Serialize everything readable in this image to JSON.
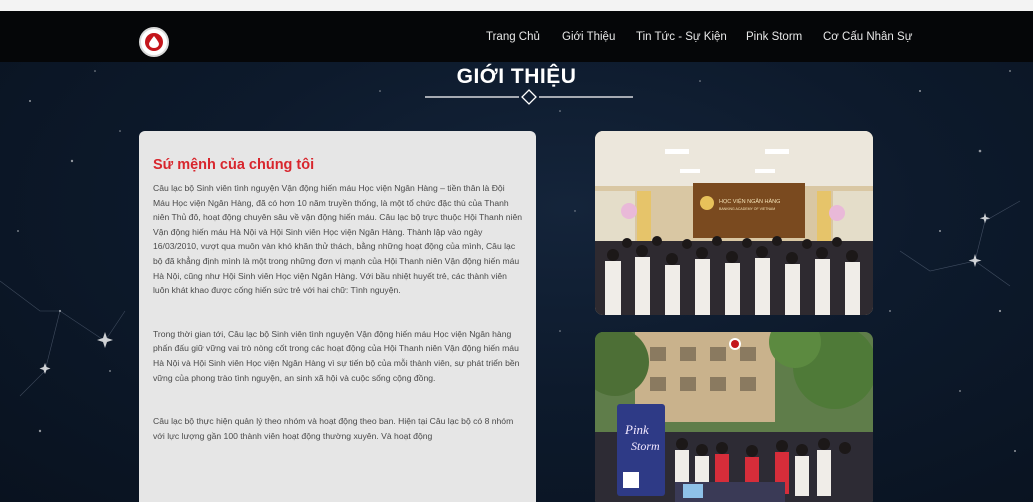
{
  "nav": {
    "items": [
      "Trang Chủ",
      "Giới Thiệu",
      "Tin Tức - Sự Kiện",
      "Pink Storm",
      "Cơ Cấu Nhân Sự"
    ]
  },
  "section_title": "GIỚI THIỆU",
  "mission": {
    "heading": "Sứ mệnh của chúng tôi",
    "paragraphs": [
      "Câu lạc bộ Sinh viên tình nguyện Vận động hiến máu Học viện Ngân Hàng – tiền thân là Đội Máu Học viện Ngân Hàng, đã có hơn 10 năm truyền thống, là một tổ chức đặc thù của Thanh niên Thủ đô, hoạt động chuyên sâu về vận động hiến máu. Câu lạc bộ trực thuộc Hội Thanh niên Vận động hiến máu Hà Nội và Hội Sinh viên Học viện Ngân Hàng. Thành lập vào ngày 16/03/2010, vượt qua muôn vàn khó khăn thử thách, bằng những hoạt động của mình, Câu lạc bộ đã khẳng định mình là một trong những đơn vị mạnh của Hội Thanh niên Vận động hiến máu Hà Nội, cũng như Hội Sinh viên Học viện Ngân Hàng. Với bầu nhiệt huyết trẻ, các thành viên luôn khát khao được cống hiến sức trẻ với hai chữ: Tình nguyện.",
      "Trong thời gian tới, Câu lạc bộ Sinh viên tình nguyện Vận động hiến máu Học viện Ngân hàng phấn đấu giữ vững vai trò nòng cốt trong các hoạt động của Hội Thanh niên Vận động hiến máu Hà Nội và Hội Sinh viên Học viện Ngân Hàng vì sự tiến bộ của mỗi thành viên, sự phát triển bền vững của phong trào tình nguyện, an sinh xã hội và cuộc sống cộng đồng.",
      "Câu lạc bộ thực hiện quản lý theo nhóm và hoạt động theo ban. Hiện tại Câu lạc bộ có 8 nhóm với lực lượng gần 100 thành viên hoạt động thường xuyên. Và hoạt động"
    ]
  },
  "photos": {
    "banner_text": "HỌC VIỆN NGÂN HÀNG",
    "banner_subtext": "BANKING ACADEMY OF VIETNAM",
    "sign_line1": "Pink",
    "sign_line2": "Storm"
  },
  "colors": {
    "navbar_bg": "#050608",
    "page_bg": "#0b1526",
    "card_bg": "#e6e6e6",
    "heading_red": "#d8262d",
    "logo_red": "#c4161c"
  }
}
